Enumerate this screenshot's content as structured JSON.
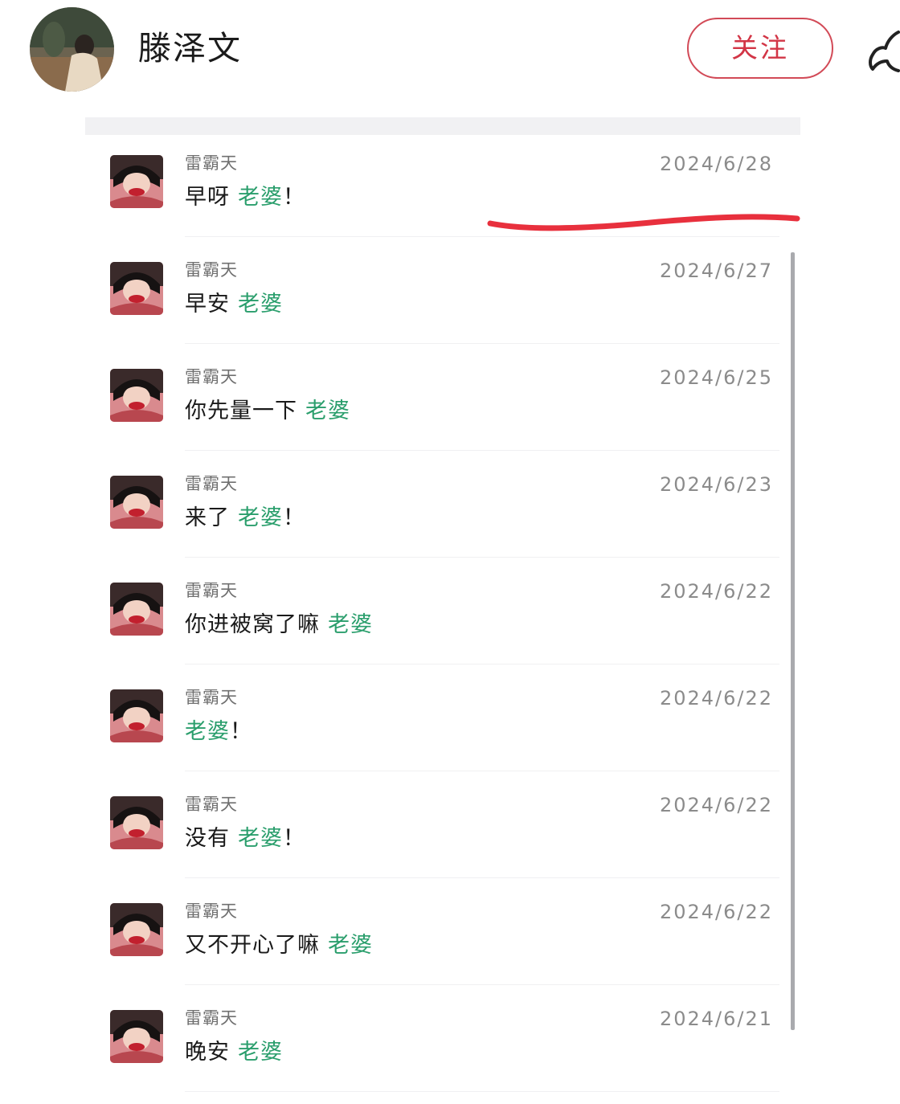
{
  "header": {
    "user_name": "滕泽文",
    "follow_label": "关注"
  },
  "colors": {
    "follow_border": "#d24a57",
    "keyword_green": "#2a9e6c",
    "annotation_red": "#e8303d"
  },
  "icons": {
    "share": "share-arrow-icon"
  },
  "messages": [
    {
      "sender": "雷霸天",
      "date": "2024/6/28",
      "text": "早呀",
      "keyword": "老婆",
      "tail": "！"
    },
    {
      "sender": "雷霸天",
      "date": "2024/6/27",
      "text": "早安",
      "keyword": "老婆",
      "tail": ""
    },
    {
      "sender": "雷霸天",
      "date": "2024/6/25",
      "text": "你先量一下",
      "keyword": "老婆",
      "tail": ""
    },
    {
      "sender": "雷霸天",
      "date": "2024/6/23",
      "text": "来了",
      "keyword": "老婆",
      "tail": "！"
    },
    {
      "sender": "雷霸天",
      "date": "2024/6/22",
      "text": "你进被窝了嘛",
      "keyword": "老婆",
      "tail": ""
    },
    {
      "sender": "雷霸天",
      "date": "2024/6/22",
      "text": "",
      "keyword": "老婆",
      "tail": "！"
    },
    {
      "sender": "雷霸天",
      "date": "2024/6/22",
      "text": "没有",
      "keyword": "老婆",
      "tail": "！"
    },
    {
      "sender": "雷霸天",
      "date": "2024/6/22",
      "text": "又不开心了嘛",
      "keyword": "老婆",
      "tail": ""
    },
    {
      "sender": "雷霸天",
      "date": "2024/6/21",
      "text": "晚安",
      "keyword": "老婆",
      "tail": ""
    }
  ]
}
